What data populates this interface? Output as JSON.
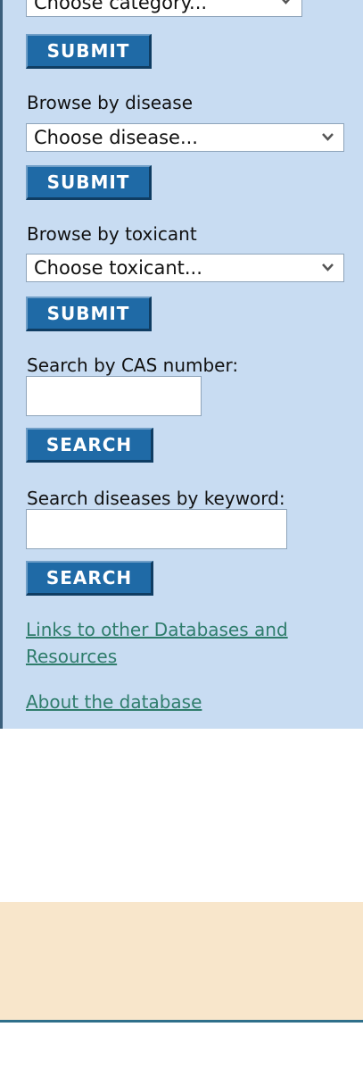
{
  "sidebar": {
    "category_select": {
      "value": "Choose category...",
      "icon": "chevron-down-icon"
    },
    "category_submit": "SUBMIT",
    "disease_label": "Browse by disease",
    "disease_select": {
      "value": "Choose disease...",
      "icon": "chevron-down-icon"
    },
    "disease_submit": "SUBMIT",
    "toxicant_label": "Browse by toxicant",
    "toxicant_select": {
      "value": "Choose toxicant...",
      "icon": "chevron-down-icon"
    },
    "toxicant_submit": "SUBMIT",
    "cas_label": "Search by CAS number:",
    "cas_input_value": "",
    "cas_search": "SEARCH",
    "keyword_label": "Search diseases by keyword:",
    "keyword_input_value": "",
    "keyword_search": "SEARCH",
    "links_line1": "Links to other Databases and",
    "links_line2": "Resources",
    "about_link": "About the database"
  },
  "colors": {
    "sidebar_bg": "#c8dcf2",
    "button_bg": "#1f6aa6",
    "link": "#2f7d6c",
    "footer_band": "#f8e6cb"
  }
}
